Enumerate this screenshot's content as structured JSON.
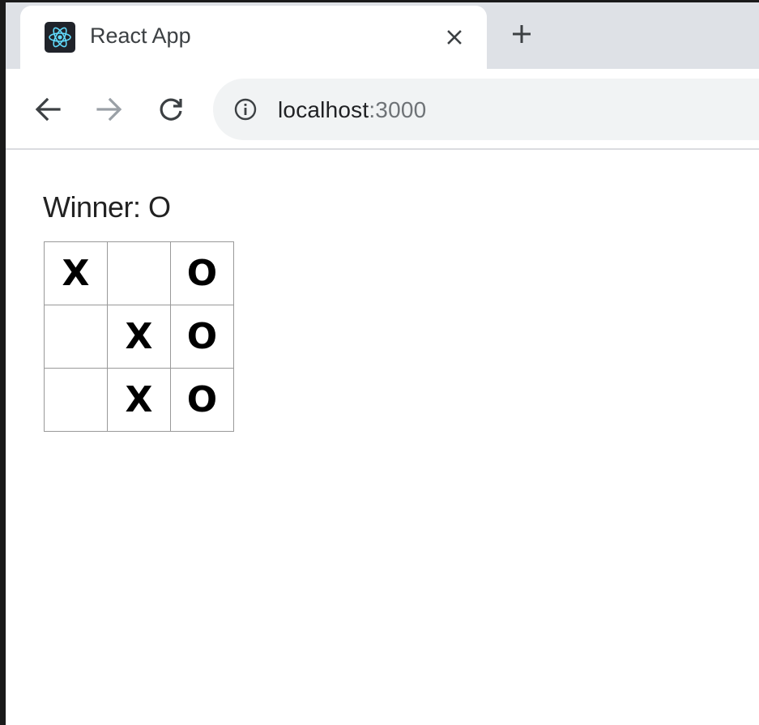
{
  "browser": {
    "tab_title": "React App",
    "favicon": "react-logo-icon",
    "url_host": "localhost",
    "url_port": ":3000",
    "icons": {
      "close": "close-icon",
      "new_tab": "plus-icon",
      "back": "arrow-left-icon",
      "forward": "arrow-right-icon",
      "reload": "reload-icon",
      "site_info": "info-icon"
    }
  },
  "game": {
    "status": "Winner: O",
    "board": [
      [
        "X",
        "",
        "O"
      ],
      [
        "",
        "X",
        "O"
      ],
      [
        "",
        "X",
        "O"
      ]
    ]
  }
}
